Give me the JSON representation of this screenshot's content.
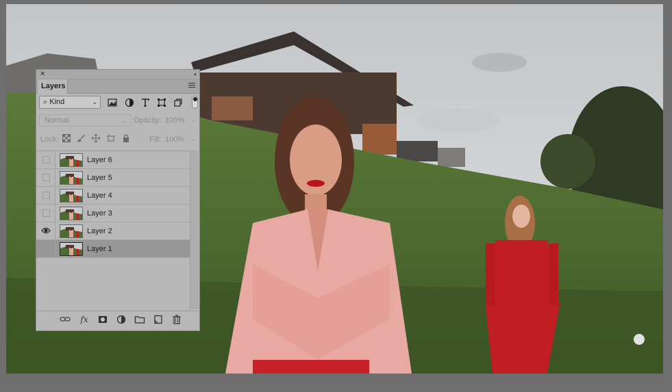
{
  "panel": {
    "close_glyph": "✕",
    "collapse_glyph": "‹‹",
    "tab_label": "Layers",
    "menu_icon": "hamburger-menu-icon"
  },
  "filter": {
    "kind_label": "Kind",
    "kind_search_glyph": "⌕",
    "dropdown_glyph": "⌄",
    "icons": [
      "image-filter-icon",
      "adjustment-filter-icon",
      "type-filter-icon",
      "shape-filter-icon",
      "smart-object-filter-icon"
    ]
  },
  "blend": {
    "mode": "Normal",
    "opacity_label": "Opacity:",
    "opacity_value": "100%"
  },
  "lock": {
    "label": "Lock:",
    "fill_label": "Fill:",
    "fill_value": "100%",
    "icons": [
      "lock-transparent-icon",
      "lock-brush-icon",
      "lock-move-icon",
      "lock-artboard-icon",
      "lock-all-icon"
    ]
  },
  "layers": [
    {
      "name": "Layer 6",
      "visible": false,
      "selected": false
    },
    {
      "name": "Layer 5",
      "visible": false,
      "selected": false
    },
    {
      "name": "Layer 4",
      "visible": false,
      "selected": false
    },
    {
      "name": "Layer 3",
      "visible": false,
      "selected": false
    },
    {
      "name": "Layer 2",
      "visible": true,
      "selected": false
    },
    {
      "name": "Layer 1",
      "visible": false,
      "selected": true
    }
  ],
  "footer": {
    "fx_label": "fx",
    "icons": [
      "link-layers-icon",
      "fx-icon",
      "add-mask-icon",
      "adjustment-layer-icon",
      "new-group-icon",
      "new-layer-icon",
      "trash-icon"
    ]
  },
  "colors": {
    "panel_bg": "#b8b8b8",
    "selected_row": "#979797",
    "workspace_bg": "#6e6e6e"
  }
}
